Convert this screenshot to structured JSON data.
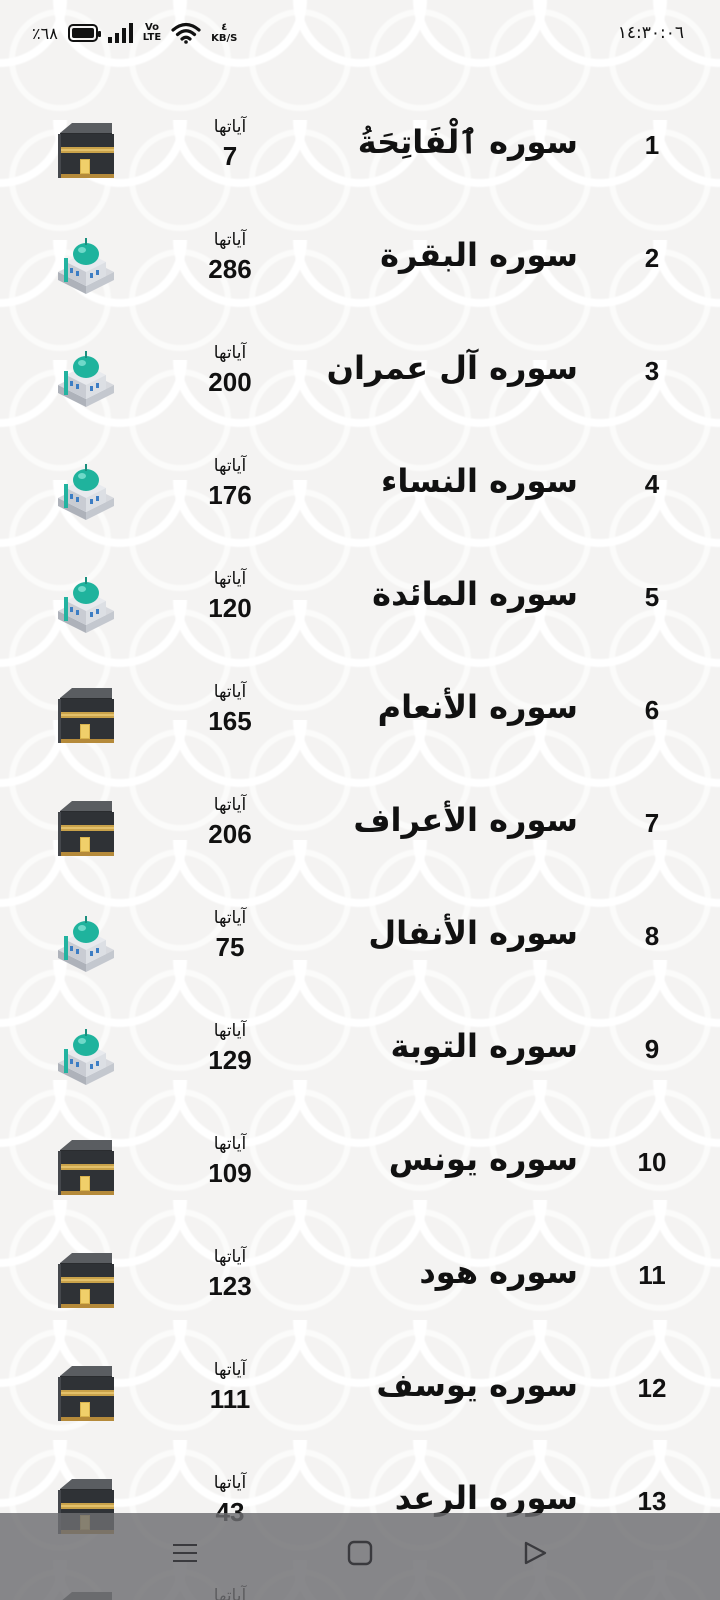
{
  "status_bar": {
    "battery_text": "٪٦٨",
    "volte_top": "Vo",
    "volte_bottom": "LTE",
    "net_speed_value": "٤",
    "net_speed_unit": "KB/S",
    "clock": "١٤:٣٠:٠٦"
  },
  "ayat_label": "آياتها",
  "surahs": [
    {
      "number": "1",
      "name": "سوره ٱلْفَاتِحَةُ",
      "ayat": "7",
      "icon": "kaaba-icon"
    },
    {
      "number": "2",
      "name": "سوره البقرة",
      "ayat": "286",
      "icon": "mosque-icon"
    },
    {
      "number": "3",
      "name": "سوره آل عمران",
      "ayat": "200",
      "icon": "mosque-icon"
    },
    {
      "number": "4",
      "name": "سوره النساء",
      "ayat": "176",
      "icon": "mosque-icon"
    },
    {
      "number": "5",
      "name": "سوره المائدة",
      "ayat": "120",
      "icon": "mosque-icon"
    },
    {
      "number": "6",
      "name": "سوره الأنعام",
      "ayat": "165",
      "icon": "kaaba-icon"
    },
    {
      "number": "7",
      "name": "سوره الأعراف",
      "ayat": "206",
      "icon": "kaaba-icon"
    },
    {
      "number": "8",
      "name": "سوره الأنفال",
      "ayat": "75",
      "icon": "mosque-icon"
    },
    {
      "number": "9",
      "name": "سوره التوبة",
      "ayat": "129",
      "icon": "mosque-icon"
    },
    {
      "number": "10",
      "name": "سوره يونس",
      "ayat": "109",
      "icon": "kaaba-icon"
    },
    {
      "number": "11",
      "name": "سوره هود",
      "ayat": "123",
      "icon": "kaaba-icon"
    },
    {
      "number": "12",
      "name": "سوره يوسف",
      "ayat": "111",
      "icon": "kaaba-icon"
    },
    {
      "number": "13",
      "name": "سوره الرعد",
      "ayat": "43",
      "icon": "kaaba-icon"
    },
    {
      "number": "",
      "name": "",
      "ayat": "",
      "icon": "kaaba-icon"
    }
  ],
  "nav_bar": {
    "menu": "menu-icon",
    "home": "home-square-icon",
    "back": "back-triangle-icon"
  }
}
